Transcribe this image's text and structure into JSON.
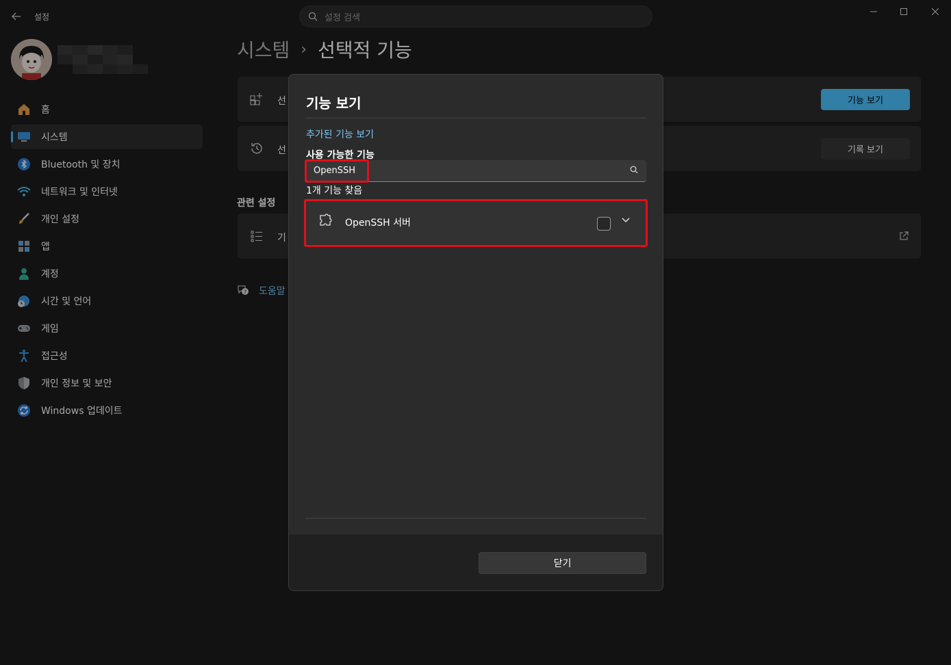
{
  "app": {
    "title": "설정",
    "search_placeholder": "설정 검색"
  },
  "sidebar": {
    "items": [
      {
        "label": "홈",
        "icon": "home-icon"
      },
      {
        "label": "시스템",
        "icon": "monitor-icon"
      },
      {
        "label": "Bluetooth 및 장치",
        "icon": "bluetooth-icon"
      },
      {
        "label": "네트워크 및 인터넷",
        "icon": "wifi-icon"
      },
      {
        "label": "개인 설정",
        "icon": "brush-icon"
      },
      {
        "label": "앱",
        "icon": "apps-icon"
      },
      {
        "label": "계정",
        "icon": "person-icon"
      },
      {
        "label": "시간 및 언어",
        "icon": "globe-clock-icon"
      },
      {
        "label": "게임",
        "icon": "gamepad-icon"
      },
      {
        "label": "접근성",
        "icon": "accessibility-icon"
      },
      {
        "label": "개인 정보 및 보안",
        "icon": "shield-icon"
      },
      {
        "label": "Windows 업데이트",
        "icon": "update-icon"
      }
    ],
    "active_index": 1
  },
  "main": {
    "breadcrumb_parent": "시스템",
    "breadcrumb_separator": "›",
    "breadcrumb_current": "선택적 기능",
    "card1_label": "선",
    "card1_button": "기능 보기",
    "card2_label": "선",
    "card2_button": "기록 보기",
    "related_title": "관련 설정",
    "card3_label": "기",
    "help_label": "도움말"
  },
  "dialog": {
    "title": "기능 보기",
    "added_link": "추가된 기능 보기",
    "available_title": "사용 가능한 기능",
    "search_value": "OpenSSH",
    "result_count": "1개 기능 찾음",
    "feature_name": "OpenSSH 서버",
    "feature_checked": false,
    "close_label": "닫기"
  },
  "colors": {
    "accent": "#4cc2ff",
    "highlight": "#e0101c",
    "background": "#1c1c1c",
    "card": "#2b2b2b"
  }
}
